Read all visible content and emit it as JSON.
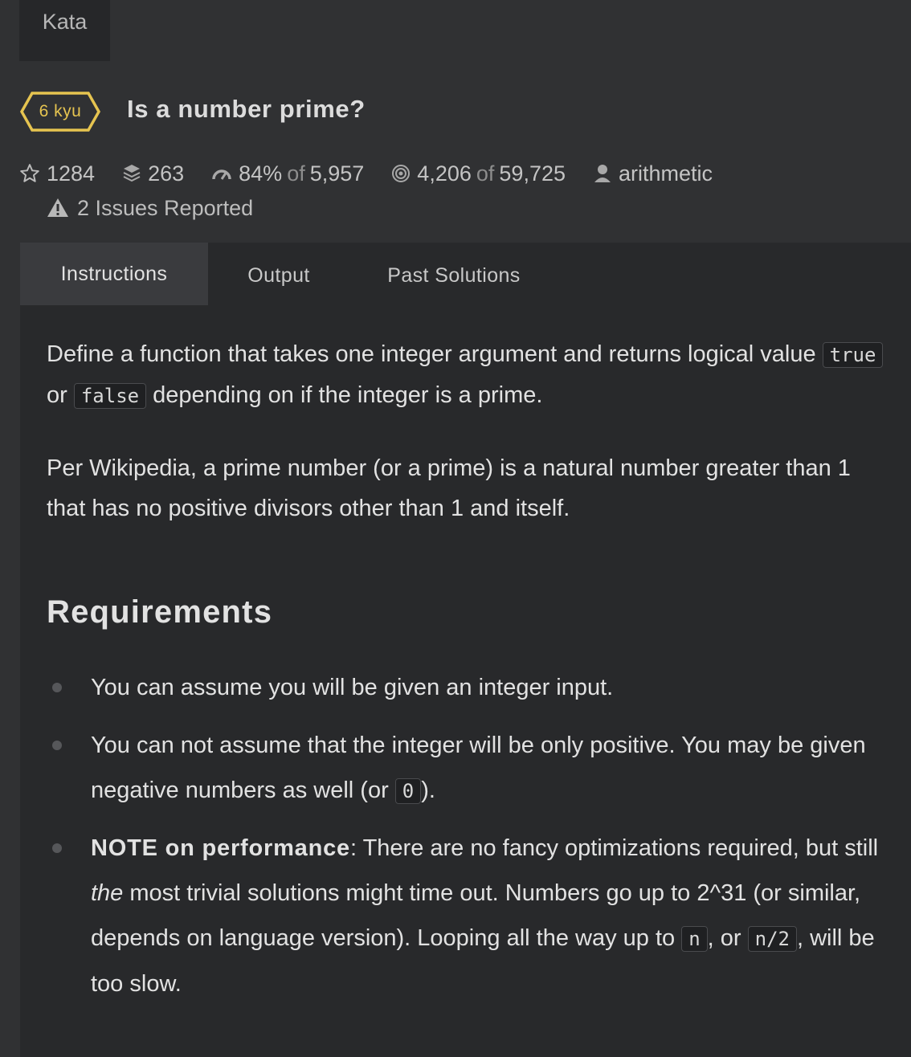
{
  "header": {
    "top_tab_label": "Kata"
  },
  "kata": {
    "rank": "6 kyu",
    "title": "Is a number prime?",
    "rank_color": "#e6c450"
  },
  "stats": {
    "stars": "1284",
    "collections": "263",
    "satisfaction_pct": "84%",
    "satisfaction_of_word": "of",
    "satisfaction_votes": "5,957",
    "completed": "4,206",
    "completed_of_word": "of",
    "attempts": "59,725",
    "author": "arithmetic",
    "issues": "2 Issues Reported"
  },
  "tabs": [
    {
      "label": "Instructions",
      "active": true
    },
    {
      "label": "Output",
      "active": false
    },
    {
      "label": "Past Solutions",
      "active": false
    }
  ],
  "description": {
    "p1_part1": "Define a function that takes one integer argument and returns logical value ",
    "p1_code1": "true",
    "p1_or": " or ",
    "p1_code2": "false",
    "p1_part2": " depending on if the integer is a prime.",
    "p2": "Per Wikipedia, a prime number (or a prime) is a natural number greater than 1 that has no positive divisors other than 1 and itself.",
    "requirements_heading": "Requirements",
    "req1": "You can assume you will be given an integer input.",
    "req2_part1": "You can not assume that the integer will be only positive. You may be given negative numbers as well (or ",
    "req2_code": "0",
    "req2_part2": ").",
    "req3_bold": "NOTE on performance",
    "req3_part1": ": There are no fancy optimizations required, but still ",
    "req3_italic": "the",
    "req3_part2": " most trivial solutions might time out. Numbers go up to 2^31 (or similar, depends on language version). Looping all the way up to ",
    "req3_code1": "n",
    "req3_or": ", or ",
    "req3_code2": "n/2",
    "req3_part3": ", will be too slow."
  }
}
